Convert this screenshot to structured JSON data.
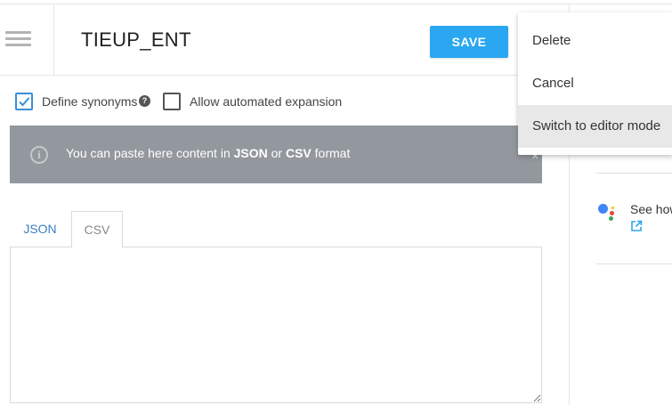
{
  "header": {
    "title": "TIEUP_ENT",
    "save_label": "SAVE"
  },
  "options": {
    "define_synonyms_label": "Define synonyms",
    "define_synonyms_checked": true,
    "allow_expansion_label": "Allow automated expansion",
    "allow_expansion_checked": false
  },
  "banner": {
    "text_prefix": "You can paste here content in ",
    "format_json": "JSON",
    "text_or": " or ",
    "format_csv": "CSV",
    "text_suffix": " format"
  },
  "tabs": [
    {
      "label": "JSON",
      "active": false
    },
    {
      "label": "CSV",
      "active": true
    }
  ],
  "editor": {
    "value": ""
  },
  "side_panel": {
    "see_how_text": "See how"
  },
  "menu": {
    "items": [
      {
        "label": "Delete"
      },
      {
        "label": "Cancel"
      },
      {
        "label": "Switch to editor mode",
        "hovered": true
      }
    ]
  },
  "icons": {
    "menu": "hamburger-icon",
    "help": "help-icon",
    "info": "info-icon",
    "assistant": "google-assistant-icon",
    "external": "external-link-icon"
  },
  "colors": {
    "primary": "#2aa7f0",
    "link": "#3b7fc4",
    "banner_bg": "#93979e",
    "checkbox_accent": "#3b8fd9"
  }
}
